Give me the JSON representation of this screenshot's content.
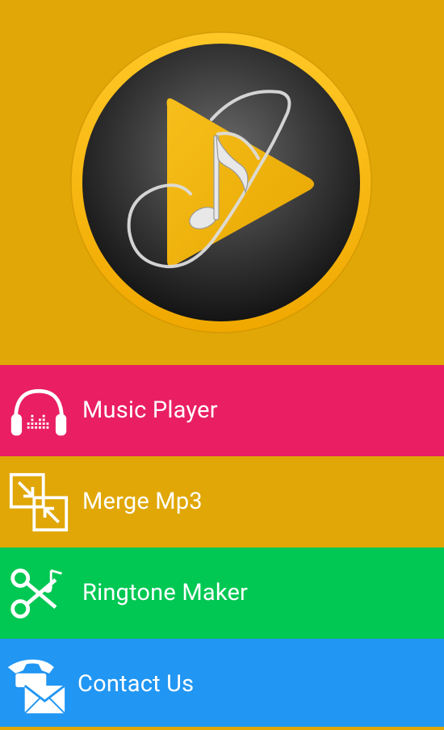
{
  "hero": {
    "logo_icon": "play-music-note-logo-icon",
    "background_color": "#e0a707",
    "ring_color": "#f6b614"
  },
  "menu": [
    {
      "label": "Music Player",
      "icon": "headphones-equalizer-icon",
      "color": "#e91e63"
    },
    {
      "label": "Merge Mp3",
      "icon": "merge-arrows-icon",
      "color": "#e0a707"
    },
    {
      "label": "Ringtone Maker",
      "icon": "scissors-music-note-icon",
      "color": "#00c853"
    },
    {
      "label": "Contact Us",
      "icon": "phone-envelope-icon",
      "color": "#2196f3"
    }
  ]
}
